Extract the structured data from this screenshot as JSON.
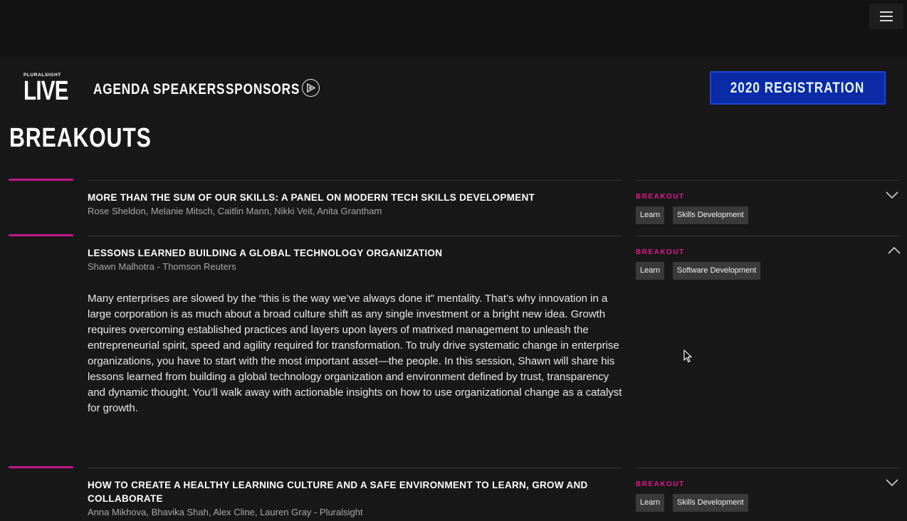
{
  "header": {
    "logo_small": "PLURALSIGHT",
    "logo_big": "LIVE",
    "nav": [
      "AGENDA",
      "SPEAKERS",
      "SPONSORS"
    ],
    "play_icon": "play-circle-icon",
    "menu_icon": "hamburger-menu-icon",
    "registration_label": "2020 REGISTRATION"
  },
  "page": {
    "title": "BREAKOUTS"
  },
  "colors": {
    "accent": "#c2168e",
    "breakout_badge": "#e0188f",
    "registration_bg": "#0a2aa6",
    "background": "#181818"
  },
  "sessions": [
    {
      "title": "MORE THAN THE SUM OF OUR SKILLS: A PANEL ON MODERN TECH SKILLS DEVELOPMENT",
      "speakers": "Rose Sheldon, Melanie Mitsch, Caitlin Mann, Nikki Veit, Anita Grantham",
      "type": "BREAKOUT",
      "tags": [
        "Learn",
        "Skills Development"
      ],
      "expanded": false
    },
    {
      "title": "LESSONS LEARNED BUILDING A GLOBAL TECHNOLOGY ORGANIZATION",
      "speakers": "Shawn Malhotra - Thomson Reuters",
      "type": "BREAKOUT",
      "tags": [
        "Learn",
        "Software Development"
      ],
      "expanded": true,
      "description": "Many enterprises are slowed by the “this is the way we’ve always done it” mentality. That’s why innovation in a large corporation is as much about a broad culture shift as any single investment or a bright new idea. Growth requires overcoming established practices and layers upon layers of matrixed management to unleash the entrepreneurial spirit, speed and agility required for transformation. To truly drive systematic change in enterprise organizations, you have to start with the most important asset—the people. In this session, Shawn will share his lessons learned from building a global technology organization and environment defined by trust, transparency and dynamic thought. You’ll walk away with actionable insights on how to use organizational change as a catalyst for growth."
    },
    {
      "title": "HOW TO CREATE A HEALTHY LEARNING CULTURE AND A SAFE ENVIRONMENT TO LEARN, GROW AND COLLABORATE",
      "speakers": "Anna Mikhova, Bhavika Shah, Alex Cline, Lauren Gray - Pluralsight",
      "type": "BREAKOUT",
      "tags": [
        "Learn",
        "Skills Development"
      ],
      "expanded": false
    }
  ]
}
